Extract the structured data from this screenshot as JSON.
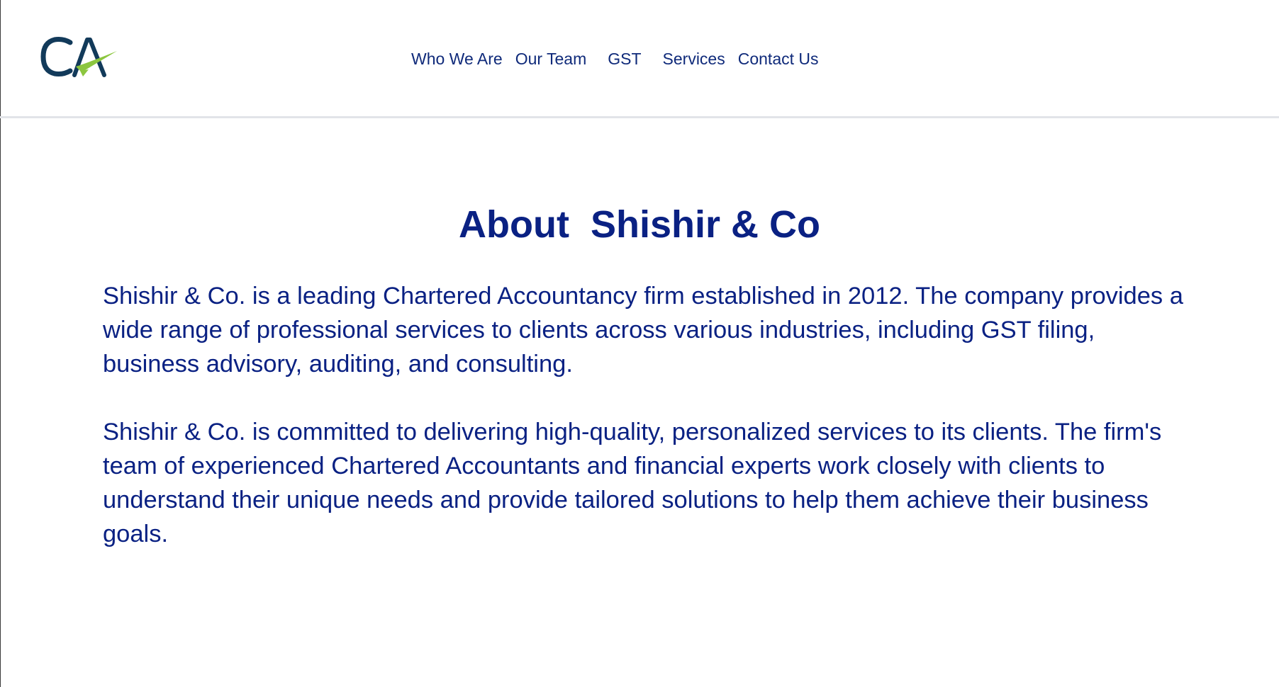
{
  "brand": {
    "logo_text": "CA",
    "colors": {
      "logo_dark": "#123a5a",
      "logo_accent": "#8cc63f",
      "text": "#0a2183",
      "nav_text": "#0f2a7a",
      "divider": "#e2e4e8"
    }
  },
  "nav": {
    "items": [
      {
        "label": "Who We Are"
      },
      {
        "label": "Our Team"
      },
      {
        "label": "GST"
      },
      {
        "label": "Services"
      },
      {
        "label": "Contact Us"
      }
    ]
  },
  "main": {
    "title": "About  Shishir & Co",
    "paragraphs": [
      "Shishir & Co. is a leading Chartered Accountancy firm established in 2012. The company provides a wide range of professional services to clients across various industries, including GST filing, business advisory, auditing, and consulting.",
      "Shishir & Co. is committed to delivering high-quality, personalized services to its clients. The firm's team of experienced Chartered Accountants and financial experts work closely with clients to understand their unique needs and provide tailored solutions to help them achieve their business goals."
    ]
  }
}
